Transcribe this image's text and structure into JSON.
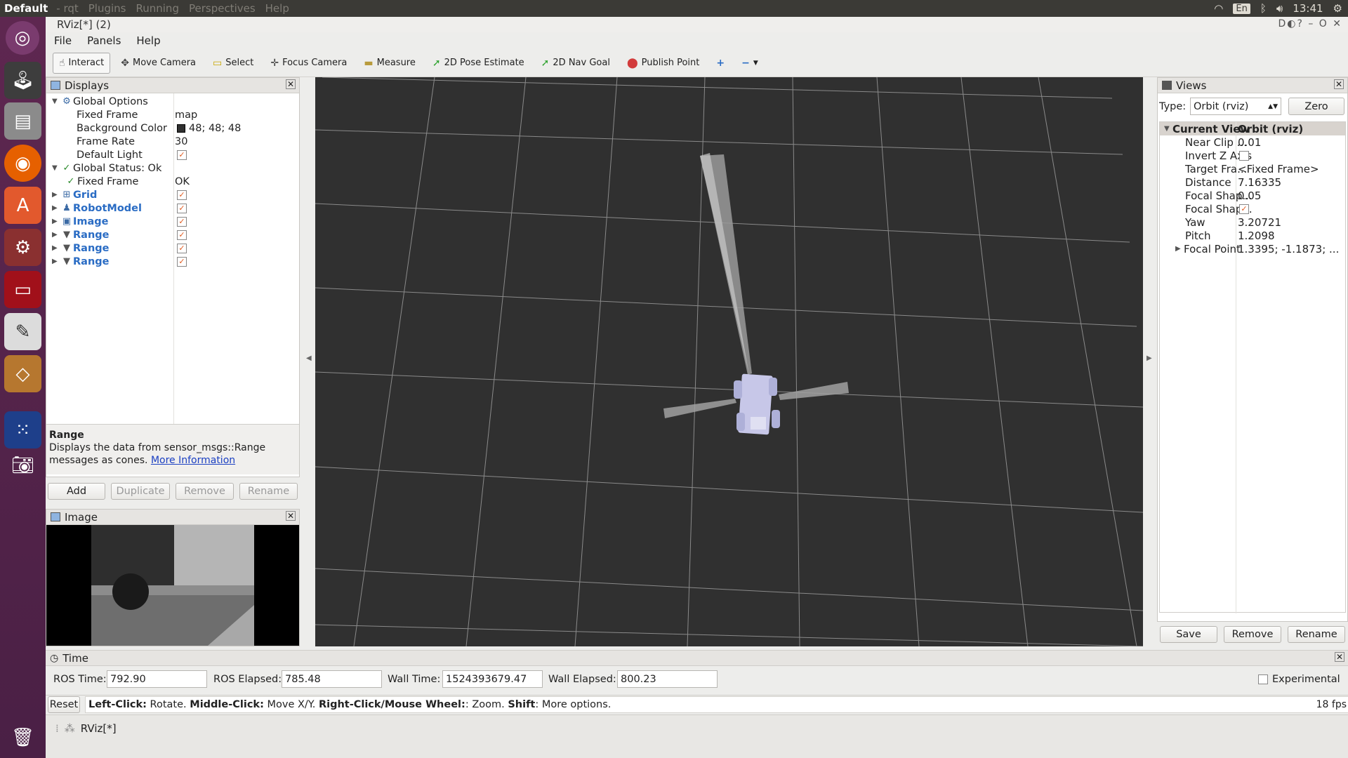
{
  "topbar": {
    "app": "Default",
    "menus": [
      "- rqt",
      "Plugins",
      "Running",
      "Perspectives",
      "Help"
    ],
    "keyboard": "En",
    "clock": "13:41",
    "icons": [
      "wifi-icon",
      "bluetooth-icon",
      "volume-icon",
      "settings-gear-icon"
    ]
  },
  "window": {
    "title": "RViz[*] (2)"
  },
  "menubar": {
    "file": "File",
    "panels": "Panels",
    "help": "Help"
  },
  "toolbar": {
    "interact": "Interact",
    "move_camera": "Move Camera",
    "select": "Select",
    "focus_camera": "Focus Camera",
    "measure": "Measure",
    "pose_estimate": "2D Pose Estimate",
    "nav_goal": "2D Nav Goal",
    "publish_point": "Publish Point",
    "add_tool": "+",
    "remove_tool": "−"
  },
  "displays": {
    "title": "Displays",
    "global_options": "Global Options",
    "fixed_frame_label": "Fixed Frame",
    "fixed_frame_value": "map",
    "bg_color_label": "Background Color",
    "bg_color_value": "48; 48; 48",
    "frame_rate_label": "Frame Rate",
    "frame_rate_value": "30",
    "default_light_label": "Default Light",
    "global_status": "Global Status: Ok",
    "status_fixed_frame": "Fixed Frame",
    "status_fixed_frame_value": "OK",
    "items": [
      "Grid",
      "RobotModel",
      "Image",
      "Range",
      "Range",
      "Range"
    ],
    "desc_title": "Range",
    "desc_text": "Displays the data from sensor_msgs::Range messages as cones.",
    "desc_link": "More Information",
    "btn_add": "Add",
    "btn_duplicate": "Duplicate",
    "btn_remove": "Remove",
    "btn_rename": "Rename"
  },
  "image_panel": {
    "title": "Image"
  },
  "views": {
    "title": "Views",
    "type_label": "Type:",
    "type_value": "Orbit (rviz)",
    "zero": "Zero",
    "current_view": "Current View",
    "current_view_value": "Orbit (rviz)",
    "props": [
      {
        "name": "Near Clip ...",
        "value": "0.01"
      },
      {
        "name": "Invert Z Axis",
        "value": ""
      },
      {
        "name": "Target Fra...",
        "value": "<Fixed Frame>"
      },
      {
        "name": "Distance",
        "value": "7.16335"
      },
      {
        "name": "Focal Shap...",
        "value": "0.05"
      },
      {
        "name": "Focal Shap...",
        "value": ""
      },
      {
        "name": "Yaw",
        "value": "3.20721"
      },
      {
        "name": "Pitch",
        "value": "1.2098"
      },
      {
        "name": "Focal Point",
        "value": "1.3395; -1.1873; ..."
      }
    ],
    "btn_save": "Save",
    "btn_remove": "Remove",
    "btn_rename": "Rename"
  },
  "time": {
    "title": "Time",
    "ros_time_label": "ROS Time:",
    "ros_time": "792.90",
    "ros_elapsed_label": "ROS Elapsed:",
    "ros_elapsed": "785.48",
    "wall_time_label": "Wall Time:",
    "wall_time": "1524393679.47",
    "wall_elapsed_label": "Wall Elapsed:",
    "wall_elapsed": "800.23",
    "experimental": "Experimental"
  },
  "statusbar": {
    "reset": "Reset",
    "hint_1b": "Left-Click:",
    "hint_1": " Rotate. ",
    "hint_2b": "Middle-Click:",
    "hint_2": " Move X/Y. ",
    "hint_3b": "Right-Click/Mouse Wheel:",
    "hint_3": ": Zoom. ",
    "hint_4b": "Shift",
    "hint_4": ": More options.",
    "fps": "18 fps"
  },
  "taskbar": {
    "item": "RViz[*]"
  }
}
